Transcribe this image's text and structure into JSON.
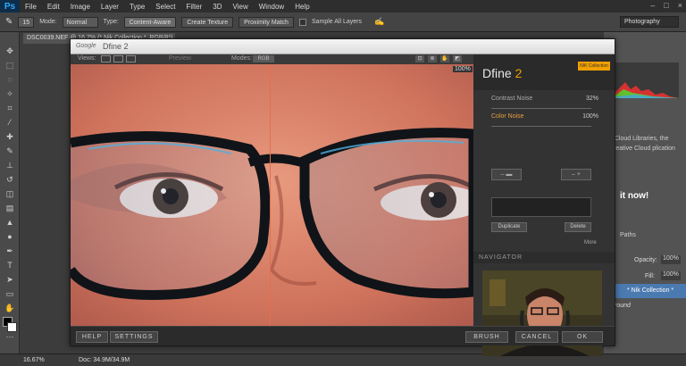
{
  "menubar": {
    "logo": "Ps",
    "items": [
      "File",
      "Edit",
      "Image",
      "Layer",
      "Type",
      "Select",
      "Filter",
      "3D",
      "View",
      "Window",
      "Help"
    ]
  },
  "options": {
    "brush_size": "15",
    "mode_label": "Mode:",
    "mode_value": "Normal",
    "type_label": "Type:",
    "type_buttons": [
      "Content-Aware",
      "Create Texture",
      "Proximity Match"
    ],
    "sample_all_layers": "Sample All Layers",
    "workspace": "Photography"
  },
  "document": {
    "tab_title": "DSC0039.NEF @ 16.7% (* Nik Collection *, RGB/8*) ×",
    "zoom": "16.67%",
    "doc_size": "Doc: 34.9M/34.9M"
  },
  "right_panel": {
    "cloud_text": "e Cloud Libraries, the Creative Cloud plication",
    "cloud_link": "it now!",
    "paths_tab": "Paths",
    "opacity_label": "Opacity:",
    "opacity_value": "100%",
    "fill_label": "Fill:",
    "fill_value": "100%",
    "layer_name": "* Nik Collection *",
    "background_layer": "round"
  },
  "dfine": {
    "brand": "Google",
    "title": "Dfine 2",
    "views_label": "Views:",
    "preview_label": "Preview",
    "modes_label": "Modes:",
    "mode_value": "RGB",
    "zoom_pct": "100%",
    "panel_title": "Dfine",
    "panel_version": "2",
    "badge": "NIK Collection",
    "contrast_noise_label": "Contrast Noise",
    "contrast_noise_value": "32%",
    "color_noise_label": "Color Noise",
    "color_noise_value": "100%",
    "duplicate": "Duplicate",
    "delete": "Delete",
    "more": "More",
    "navigator": "NAVIGATOR",
    "help": "HELP",
    "settings": "SETTINGS",
    "brush": "BRUSH",
    "cancel": "CANCEL",
    "ok": "OK"
  },
  "colors": {
    "accent": "#f0a000",
    "layer_selected": "#4a7ab0"
  }
}
